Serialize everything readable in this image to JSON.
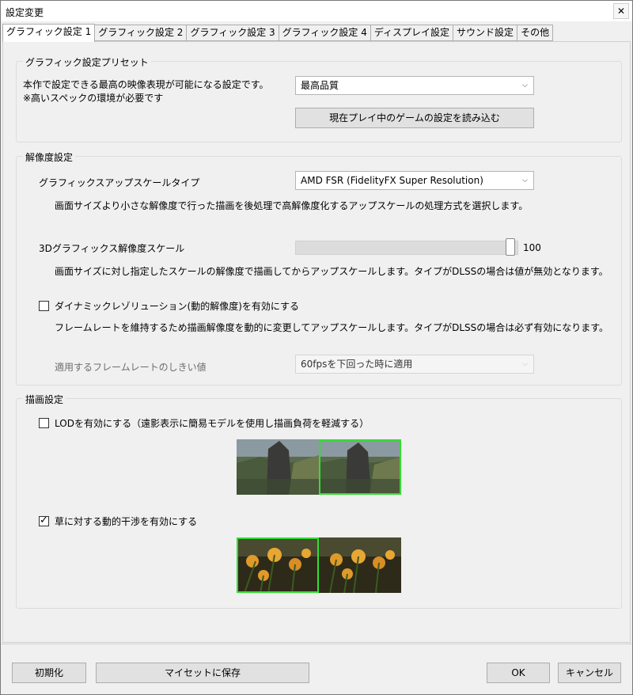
{
  "window": {
    "title": "設定変更",
    "close_label": "✕"
  },
  "tabs": [
    {
      "label": "グラフィック設定 1",
      "active": true
    },
    {
      "label": "グラフィック設定 2",
      "active": false
    },
    {
      "label": "グラフィック設定 3",
      "active": false
    },
    {
      "label": "グラフィック設定 4",
      "active": false
    },
    {
      "label": "ディスプレイ設定",
      "active": false
    },
    {
      "label": "サウンド設定",
      "active": false
    },
    {
      "label": "その他",
      "active": false
    }
  ],
  "preset": {
    "group_title": "グラフィック設定プリセット",
    "desc_line1": "本作で設定できる最高の映像表現が可能になる設定です。",
    "desc_line2": "※高いスペックの環境が必要です",
    "selected": "最高品質",
    "load_button": "現在プレイ中のゲームの設定を読み込む"
  },
  "resolution": {
    "group_title": "解像度設定",
    "upscale_label": "グラフィックスアップスケールタイプ",
    "upscale_selected": "AMD FSR (FidelityFX Super Resolution)",
    "upscale_desc": "画面サイズより小さな解像度で行った描画を後処理で高解像度化するアップスケールの処理方式を選択します。",
    "scale_label": "3Dグラフィックス解像度スケール",
    "scale_value": "100",
    "scale_fraction": 1.0,
    "scale_desc": "画面サイズに対し指定したスケールの解像度で描画してからアップスケールします。タイプがDLSSの場合は値が無効となります。",
    "dynamic_label": "ダイナミックレゾリューション(動的解像度)を有効にする",
    "dynamic_checked": false,
    "dynamic_desc": "フレームレートを維持するため描画解像度を動的に変更してアップスケールします。タイプがDLSSの場合は必ず有効になります。",
    "threshold_label": "適用するフレームレートのしきい値",
    "threshold_selected": "60fpsを下回った時に適用"
  },
  "render": {
    "group_title": "描画設定",
    "lod_label": "LODを有効にする（遠影表示に簡易モデルを使用し描画負荷を軽減する）",
    "lod_checked": false,
    "grass_label": "草に対する動的干渉を有効にする",
    "grass_checked": true,
    "check_mark": "✓"
  },
  "footer": {
    "reset": "初期化",
    "save_myset": "マイセットに保存",
    "ok": "OK",
    "cancel": "キャンセル"
  },
  "colors": {
    "highlight": "#33dd33"
  },
  "icons": {
    "chevron": "chevron-down-icon",
    "close": "close-icon",
    "check": "check-icon"
  }
}
